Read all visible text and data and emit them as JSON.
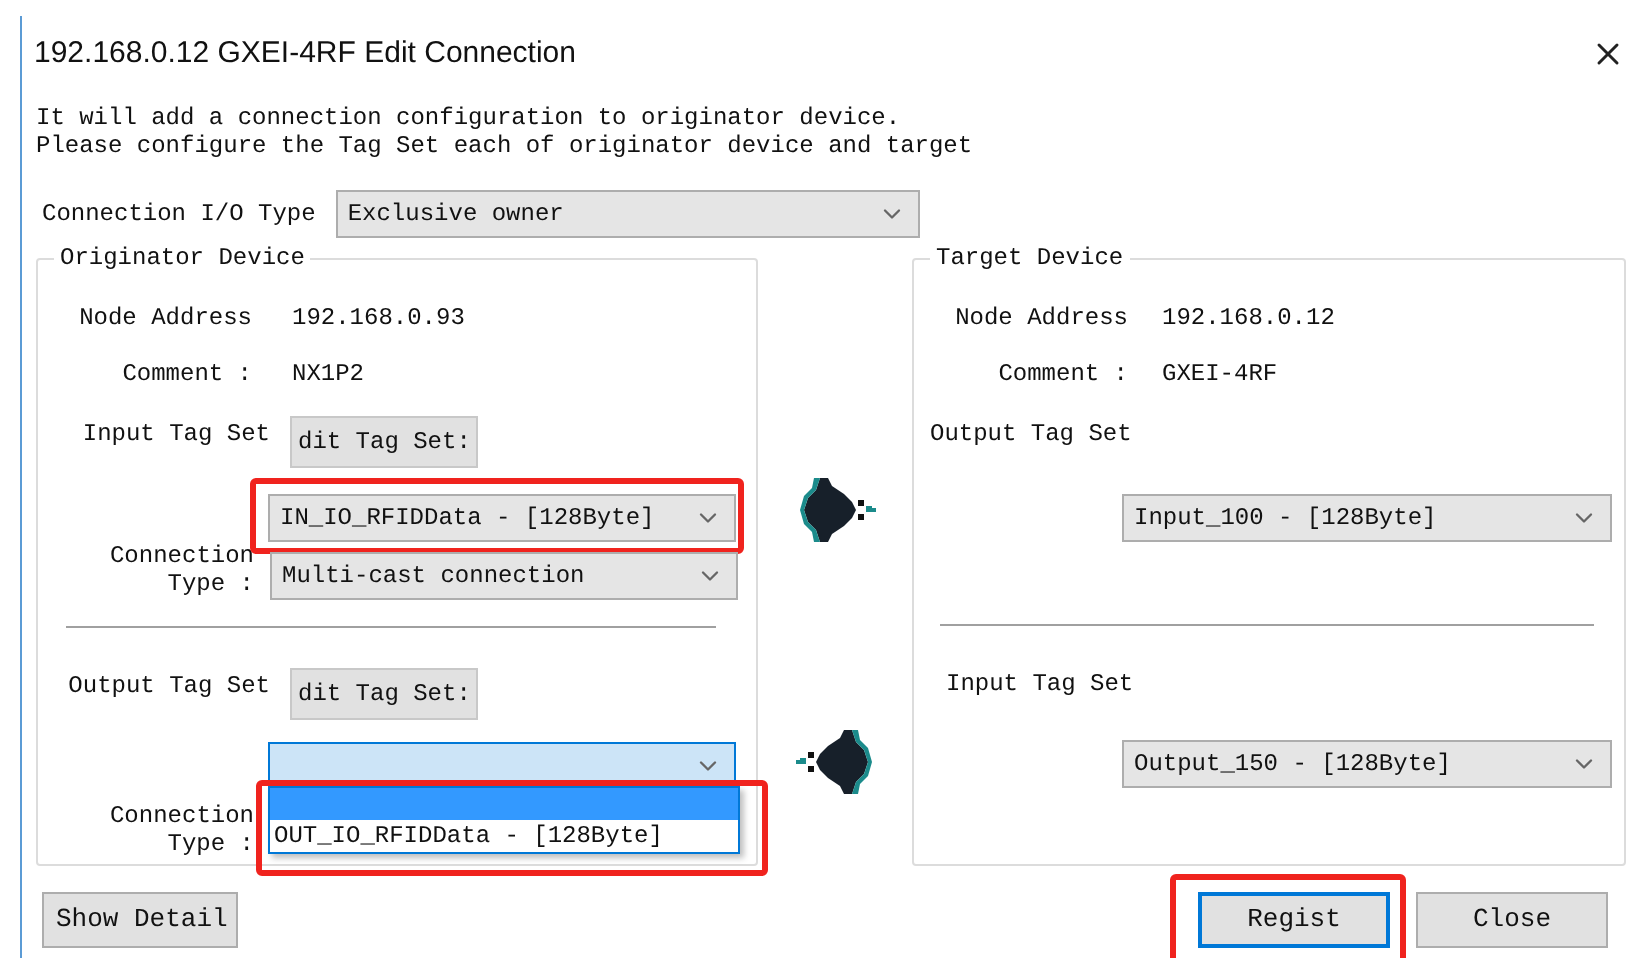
{
  "window": {
    "title": "192.168.0.12 GXEI-4RF Edit Connection"
  },
  "description": [
    "It will add a connection configuration to originator device.",
    "Please configure the Tag Set each of originator device and target"
  ],
  "connection_io_type": {
    "label": "Connection I/O Type",
    "value": "Exclusive owner"
  },
  "originator": {
    "title": "Originator Device",
    "node_address_label": "Node Address",
    "node_address": "192.168.0.93",
    "comment_label": "Comment :",
    "comment": "NX1P2",
    "input": {
      "label": "Input Tag Set",
      "button": "dit Tag Set:",
      "value": "IN_IO_RFIDData - [128Byte]",
      "highlighted": true,
      "connection_label": "Connection Type :",
      "connection_value": "Multi-cast connection"
    },
    "output": {
      "label": "Output Tag Set",
      "button": "dit Tag Set:",
      "focused": true,
      "connection_label": "Connection Type :",
      "dropdown_list": {
        "highlighted": true,
        "blank_row_selected": true,
        "items": [
          {
            "label": "OUT_IO_RFIDData - [128Byte]",
            "selected": false
          }
        ]
      }
    }
  },
  "target": {
    "title": "Target Device",
    "node_address_label": "Node Address",
    "node_address": "192.168.0.12",
    "comment_label": "Comment :",
    "comment": "GXEI-4RF",
    "output": {
      "label": "Output Tag Set",
      "value": "Input_100 - [128Byte]"
    },
    "input": {
      "label": "Input Tag Set",
      "value": "Output_150 - [128Byte]"
    }
  },
  "buttons": [
    {
      "label": "Show Detail",
      "default": false
    },
    {
      "label": "Regist",
      "default": true,
      "highlighted": true
    },
    {
      "label": "Close",
      "default": false
    }
  ]
}
